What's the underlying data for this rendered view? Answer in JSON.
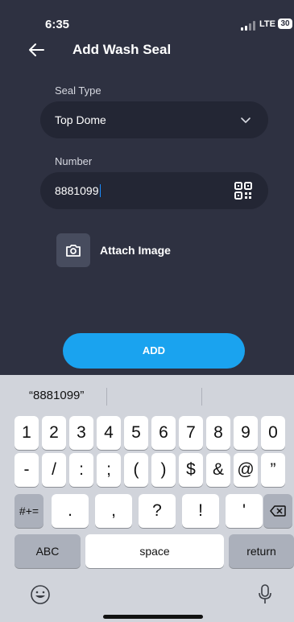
{
  "status_bar": {
    "time": "6:35",
    "network": "LTE",
    "battery": "30"
  },
  "header": {
    "title": "Add Wash Seal"
  },
  "form": {
    "seal_type_label": "Seal Type",
    "seal_type_value": "Top Dome",
    "number_label": "Number",
    "number_value": "8881099",
    "attach_label": "Attach Image",
    "submit_label": "ADD"
  },
  "keyboard": {
    "suggestion": "“8881099”",
    "row1": [
      "1",
      "2",
      "3",
      "4",
      "5",
      "6",
      "7",
      "8",
      "9",
      "0"
    ],
    "row2": [
      "-",
      "/",
      ":",
      ";",
      "(",
      ")",
      "$",
      "&",
      "@",
      "”"
    ],
    "row3": [
      ".",
      ",",
      "?",
      "!",
      "'"
    ],
    "symbols_label": "#+=",
    "abc_label": "ABC",
    "space_label": "space",
    "return_label": "return"
  },
  "colors": {
    "background": "#2e3141",
    "field": "#232634",
    "accent": "#1aa3ef",
    "keyboard": "#d1d4db"
  }
}
